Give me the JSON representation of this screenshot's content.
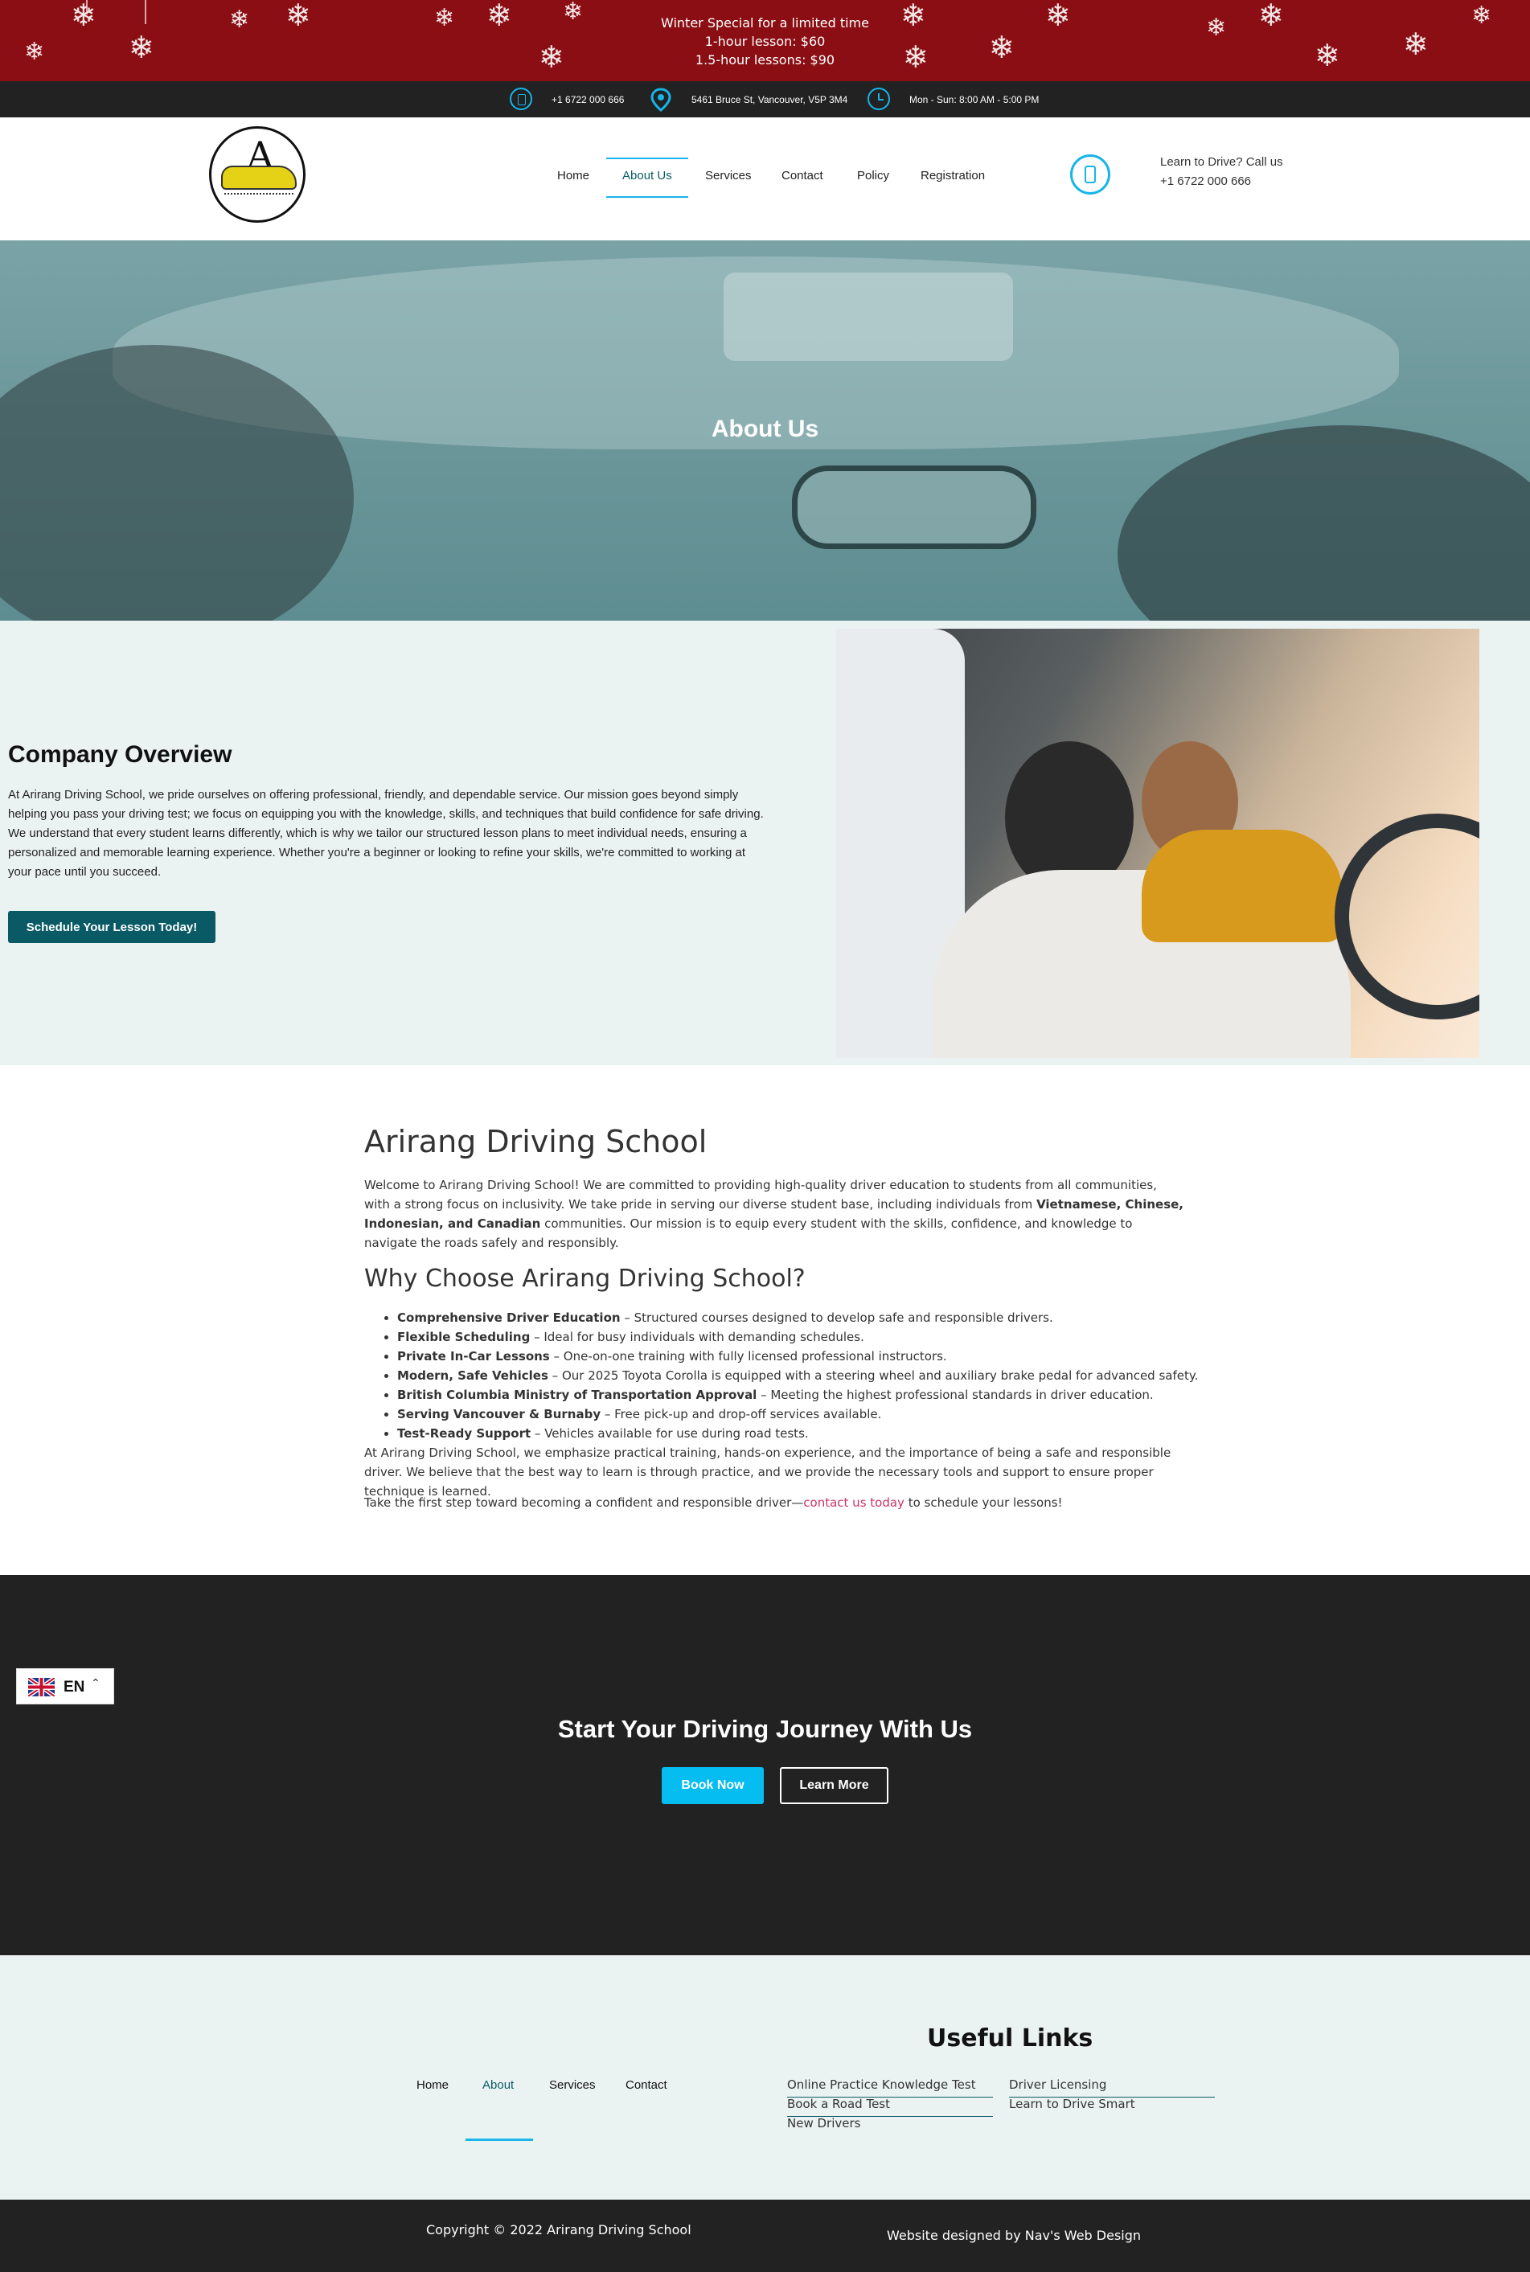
{
  "promo": {
    "lines": [
      "Winter Special for a limited time",
      "1-hour lesson: $60",
      "1.5-hour lessons: $90"
    ]
  },
  "contact_strip": {
    "phone": "+1 6722 000 666",
    "address": "5461 Bruce St, Vancouver, V5P 3M4",
    "hours": "Mon - Sun: 8:00 AM - 5:00 PM"
  },
  "header": {
    "nav": [
      "Home",
      "About Us",
      "Services",
      "Contact",
      "Policy",
      "Registration"
    ],
    "active_nav": "About Us",
    "call_label": "Learn to Drive? Call us",
    "call_number": "+1 6722 000 666"
  },
  "hero": {
    "title": "About Us"
  },
  "overview": {
    "title": "Company Overview",
    "paragraph": "At Arirang Driving School, we pride ourselves on offering professional, friendly, and dependable service. Our mission goes beyond simply helping you pass your driving test; we focus on equipping you with the knowledge, skills, and techniques that build confidence for safe driving. We understand that every student learns differently, which is why we tailor our structured lesson plans to meet individual needs, ensuring a personalized and memorable learning experience. Whether you're a beginner or looking to refine your skills, we're committed to working at your pace until you succeed.",
    "button": "Schedule Your Lesson Today!"
  },
  "about": {
    "title": "Arirang Driving School",
    "intro_pre": "Welcome to Arirang Driving School! We are committed to providing high-quality driver education to students from all communities, with a strong focus on inclusivity. We take pride in serving our diverse student base, including individuals from ",
    "intro_bold": "Vietnamese, Chinese, Indonesian, and Canadian",
    "intro_post": " communities. Our mission is to equip every student with the skills, confidence, and knowledge to navigate the roads safely and responsibly.",
    "why_title": "Why Choose Arirang Driving School?",
    "reasons": [
      {
        "bold": "Comprehensive Driver Education",
        "text": " – Structured courses designed to develop safe and responsible drivers."
      },
      {
        "bold": "Flexible Scheduling",
        "text": " – Ideal for busy individuals with demanding schedules."
      },
      {
        "bold": "Private In-Car Lessons",
        "text": " – One-on-one training with fully licensed professional instructors."
      },
      {
        "bold": "Modern, Safe Vehicles",
        "text": " – Our 2025 Toyota Corolla is equipped with a steering wheel and auxiliary brake pedal for advanced safety."
      },
      {
        "bold": "British Columbia Ministry of Transportation Approval",
        "text": " – Meeting the highest professional standards in driver education."
      },
      {
        "bold": "Serving Vancouver & Burnaby",
        "text": " – Free pick-up and drop-off services available."
      },
      {
        "bold": "Test-Ready Support",
        "text": " – Vehicles available for use during road tests."
      }
    ],
    "closing": "At Arirang Driving School, we emphasize practical training, hands-on experience, and the importance of being a safe and responsible driver. We believe that the best way to learn is through practice, and we provide the necessary tools and support to ensure proper technique is learned.",
    "cta_pre": "Take the first step toward becoming a confident and responsible driver—",
    "cta_link": "contact us today",
    "cta_post": " to schedule your lessons!"
  },
  "cta": {
    "title": "Start Your Driving Journey With Us",
    "book": "Book Now",
    "learn": "Learn More"
  },
  "language": {
    "code": "EN"
  },
  "footer": {
    "nav": [
      "Home",
      "About",
      "Services",
      "Contact"
    ],
    "useful_title": "Useful Links",
    "links_left": [
      "Online Practice Knowledge Test",
      "Book a Road Test",
      "New Drivers"
    ],
    "links_right": [
      "Driver Licensing",
      "Learn to Drive Smart"
    ],
    "copyright": "Copyright © 2022 Arirang Driving School",
    "credit": "Website designed  by Nav's Web Design"
  },
  "colors": {
    "promo_bg": "#8b0e14",
    "accent": "#16b5ea",
    "brand_teal": "#0a5a66",
    "dark": "#222222",
    "light_bg": "#ebf3f2",
    "link_pink": "#cc3366"
  }
}
